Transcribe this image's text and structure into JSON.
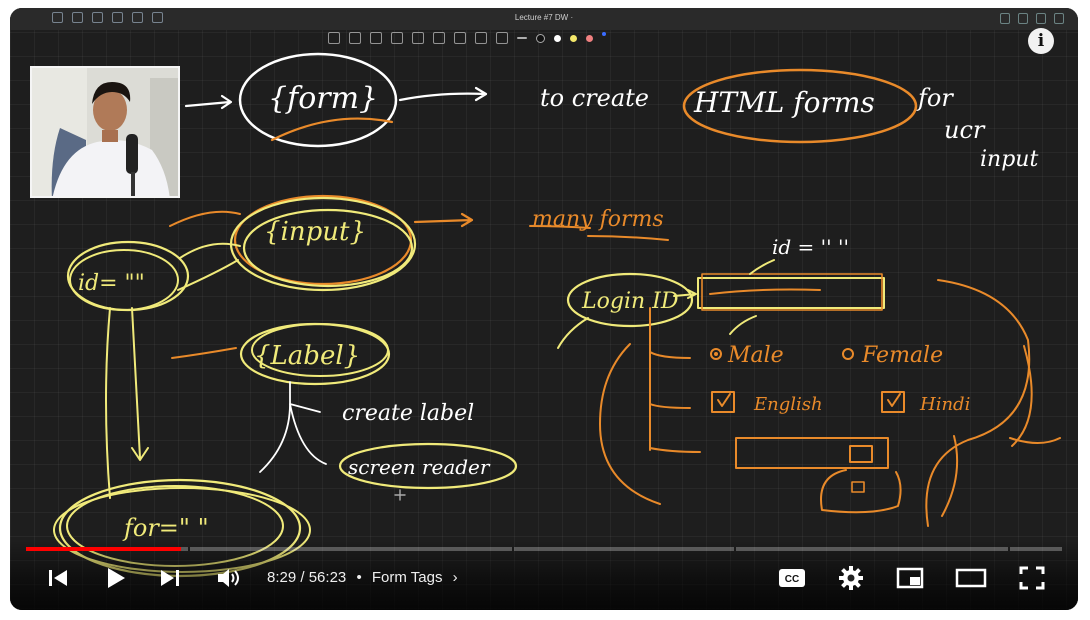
{
  "window": {
    "title": "Lecture #7 DW ·"
  },
  "info_button": {
    "label": "i"
  },
  "whiteboard": {
    "white_notes": {
      "form_tag": "{form}",
      "description_1": "to create",
      "html_forms": "HTML forms",
      "for_user_input": [
        "for",
        "ucr",
        "input"
      ]
    },
    "orange_notes": {
      "many_forms": "many forms"
    },
    "yellow_notes": {
      "input_tag": "{input}",
      "id_attr": "id= \"\"",
      "label_tag": "{Label}",
      "for_attr": "for=\"     \"",
      "login_id": "Login ID",
      "id_hint": "id = ''  ''"
    },
    "white_notes_2": {
      "create_label": "create label",
      "screen_reader": "screen reader"
    },
    "orange_notes_2": {
      "male": "Male",
      "female": "Female",
      "english": "English",
      "hindi": "Hindi"
    }
  },
  "player": {
    "current_time": "8:29",
    "separator": "/",
    "duration": "56:23",
    "bullet": "•",
    "chapter": "Form Tags",
    "progress_fraction": 0.15,
    "accent_color": "#ff0000"
  }
}
